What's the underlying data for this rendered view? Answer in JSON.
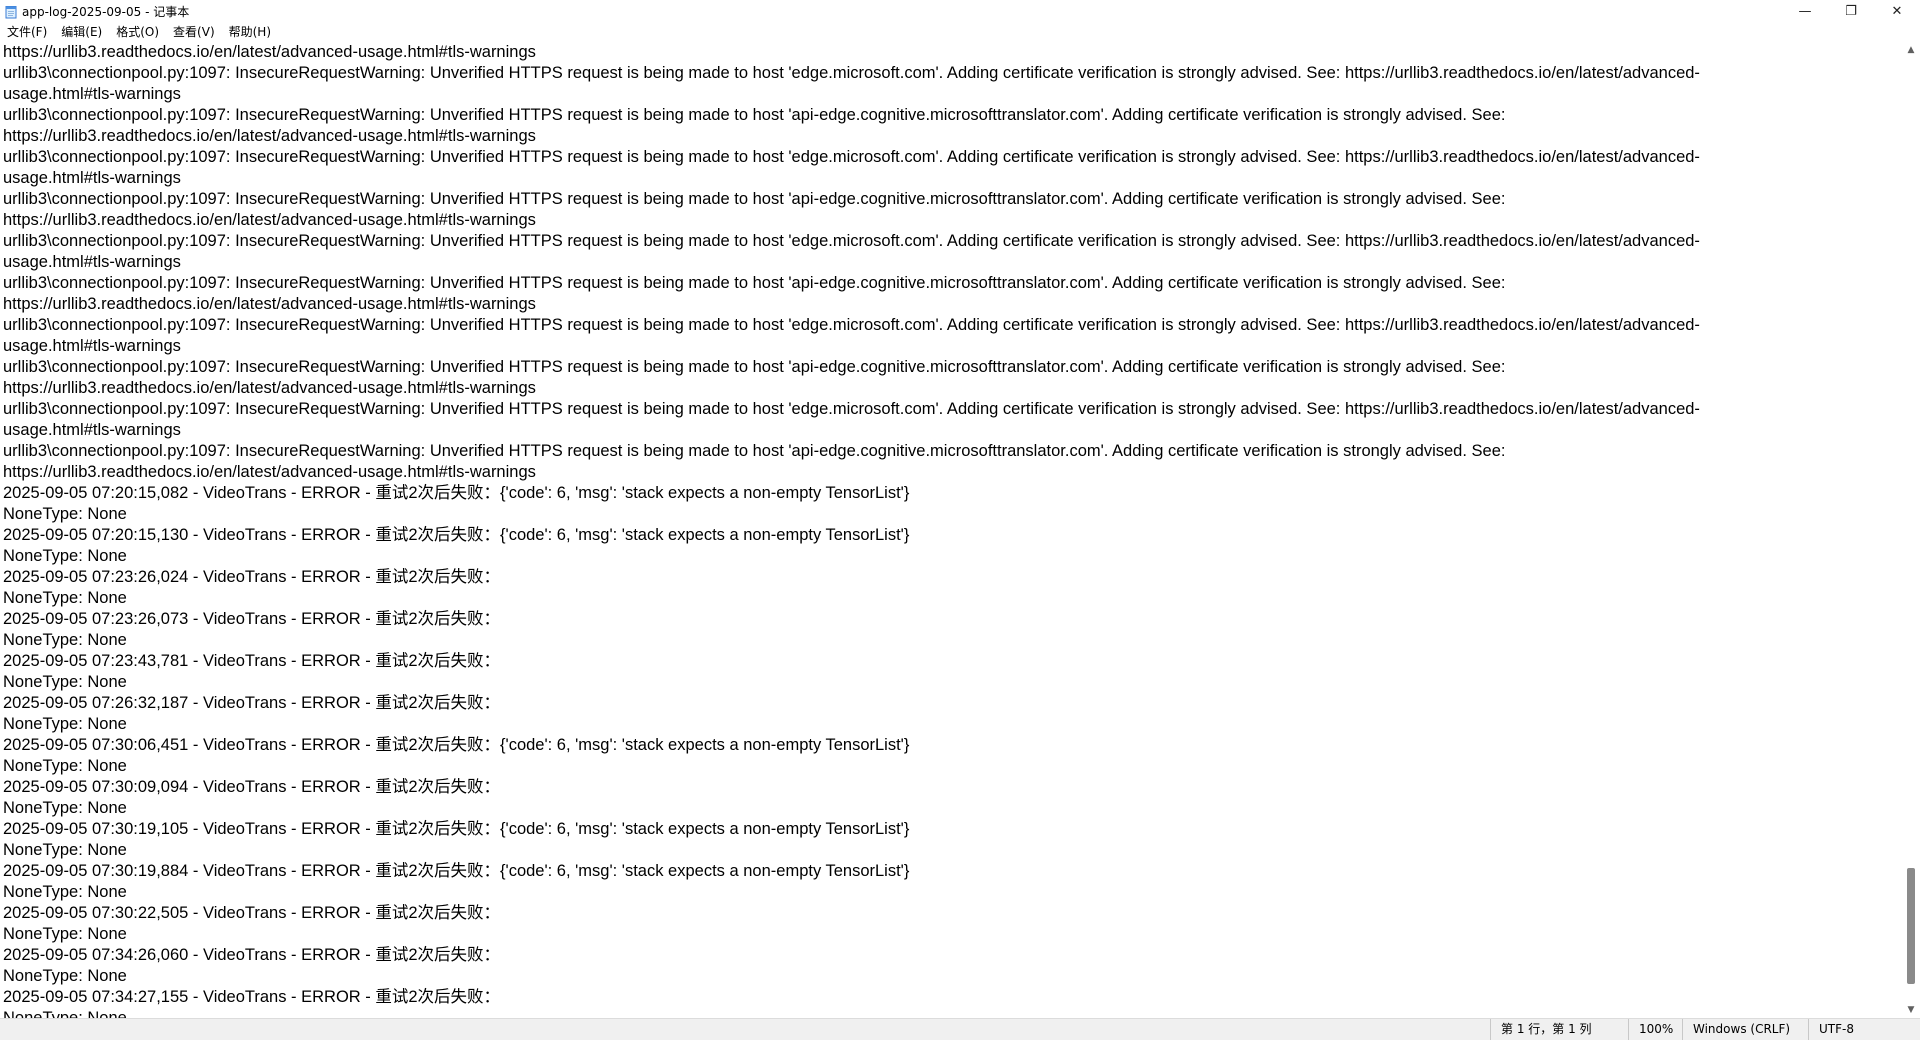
{
  "window": {
    "title": "app-log-2025-09-05 - 记事本",
    "icon": "notepad-icon",
    "minimize_glyph": "—",
    "maximize_glyph": "❐",
    "close_glyph": "✕"
  },
  "menu": {
    "items": [
      "文件(F)",
      "编辑(E)",
      "格式(O)",
      "查看(V)",
      "帮助(H)"
    ]
  },
  "editor": {
    "lines": [
      "https://urllib3.readthedocs.io/en/latest/advanced-usage.html#tls-warnings",
      "urllib3\\connectionpool.py:1097: InsecureRequestWarning: Unverified HTTPS request is being made to host 'edge.microsoft.com'. Adding certificate verification is strongly advised. See: https://urllib3.readthedocs.io/en/latest/advanced-",
      "usage.html#tls-warnings",
      "urllib3\\connectionpool.py:1097: InsecureRequestWarning: Unverified HTTPS request is being made to host 'api-edge.cognitive.microsofttranslator.com'. Adding certificate verification is strongly advised. See:",
      "https://urllib3.readthedocs.io/en/latest/advanced-usage.html#tls-warnings",
      "urllib3\\connectionpool.py:1097: InsecureRequestWarning: Unverified HTTPS request is being made to host 'edge.microsoft.com'. Adding certificate verification is strongly advised. See: https://urllib3.readthedocs.io/en/latest/advanced-",
      "usage.html#tls-warnings",
      "urllib3\\connectionpool.py:1097: InsecureRequestWarning: Unverified HTTPS request is being made to host 'api-edge.cognitive.microsofttranslator.com'. Adding certificate verification is strongly advised. See:",
      "https://urllib3.readthedocs.io/en/latest/advanced-usage.html#tls-warnings",
      "urllib3\\connectionpool.py:1097: InsecureRequestWarning: Unverified HTTPS request is being made to host 'edge.microsoft.com'. Adding certificate verification is strongly advised. See: https://urllib3.readthedocs.io/en/latest/advanced-",
      "usage.html#tls-warnings",
      "urllib3\\connectionpool.py:1097: InsecureRequestWarning: Unverified HTTPS request is being made to host 'api-edge.cognitive.microsofttranslator.com'. Adding certificate verification is strongly advised. See:",
      "https://urllib3.readthedocs.io/en/latest/advanced-usage.html#tls-warnings",
      "urllib3\\connectionpool.py:1097: InsecureRequestWarning: Unverified HTTPS request is being made to host 'edge.microsoft.com'. Adding certificate verification is strongly advised. See: https://urllib3.readthedocs.io/en/latest/advanced-",
      "usage.html#tls-warnings",
      "urllib3\\connectionpool.py:1097: InsecureRequestWarning: Unverified HTTPS request is being made to host 'api-edge.cognitive.microsofttranslator.com'. Adding certificate verification is strongly advised. See:",
      "https://urllib3.readthedocs.io/en/latest/advanced-usage.html#tls-warnings",
      "urllib3\\connectionpool.py:1097: InsecureRequestWarning: Unverified HTTPS request is being made to host 'edge.microsoft.com'. Adding certificate verification is strongly advised. See: https://urllib3.readthedocs.io/en/latest/advanced-",
      "usage.html#tls-warnings",
      "urllib3\\connectionpool.py:1097: InsecureRequestWarning: Unverified HTTPS request is being made to host 'api-edge.cognitive.microsofttranslator.com'. Adding certificate verification is strongly advised. See:",
      "https://urllib3.readthedocs.io/en/latest/advanced-usage.html#tls-warnings",
      "2025-09-05 07:20:15,082 - VideoTrans - ERROR - 重试2次后失败：{'code': 6, 'msg': 'stack expects a non-empty TensorList'}",
      "NoneType: None",
      "2025-09-05 07:20:15,130 - VideoTrans - ERROR - 重试2次后失败：{'code': 6, 'msg': 'stack expects a non-empty TensorList'}",
      "NoneType: None",
      "2025-09-05 07:23:26,024 - VideoTrans - ERROR - 重试2次后失败：",
      "NoneType: None",
      "2025-09-05 07:23:26,073 - VideoTrans - ERROR - 重试2次后失败：",
      "NoneType: None",
      "2025-09-05 07:23:43,781 - VideoTrans - ERROR - 重试2次后失败：",
      "NoneType: None",
      "2025-09-05 07:26:32,187 - VideoTrans - ERROR - 重试2次后失败：",
      "NoneType: None",
      "2025-09-05 07:30:06,451 - VideoTrans - ERROR - 重试2次后失败：{'code': 6, 'msg': 'stack expects a non-empty TensorList'}",
      "NoneType: None",
      "2025-09-05 07:30:09,094 - VideoTrans - ERROR - 重试2次后失败：",
      "NoneType: None",
      "2025-09-05 07:30:19,105 - VideoTrans - ERROR - 重试2次后失败：{'code': 6, 'msg': 'stack expects a non-empty TensorList'}",
      "NoneType: None",
      "2025-09-05 07:30:19,884 - VideoTrans - ERROR - 重试2次后失败：{'code': 6, 'msg': 'stack expects a non-empty TensorList'}",
      "NoneType: None",
      "2025-09-05 07:30:22,505 - VideoTrans - ERROR - 重试2次后失败：",
      "NoneType: None",
      "2025-09-05 07:34:26,060 - VideoTrans - ERROR - 重试2次后失败：",
      "NoneType: None",
      "2025-09-05 07:34:27,155 - VideoTrans - ERROR - 重试2次后失败：",
      "NoneType: None"
    ]
  },
  "scrollbar": {
    "up_glyph": "▲",
    "down_glyph": "▼"
  },
  "status": {
    "position": "第 1 行，第 1 列",
    "zoom": "100%",
    "line_ending": "Windows (CRLF)",
    "encoding": "UTF-8"
  }
}
